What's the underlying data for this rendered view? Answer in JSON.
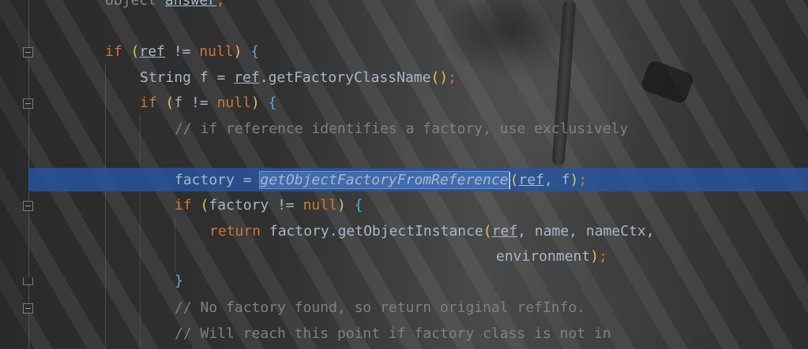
{
  "editor": {
    "lines": {
      "l0": {
        "kw": "Object",
        "var": "answer",
        "punct": ";"
      },
      "l1": {
        "kw": "if",
        "open": "(",
        "var": "ref",
        "op": " != ",
        "null": "null",
        "close": ")",
        "brace": "{"
      },
      "l2": {
        "type": "String",
        "name": " f = ",
        "var": "ref",
        "call": ".getFactoryClassName",
        "parens": "()",
        "semi": ";"
      },
      "l3": {
        "kw": "if",
        "open": "(",
        "cond": "f != ",
        "null": "null",
        "close": ")",
        "brace": "{"
      },
      "l4": {
        "comment": "// if reference identifies a factory, use exclusively"
      },
      "l5": {
        "lhs": "factory = ",
        "method": "getObjectFactoryFromReference",
        "open": "(",
        "arg1": "ref",
        "sep": ", f",
        "close": ")",
        "semi": ";"
      },
      "l6": {
        "kw": "if",
        "open": "(",
        "cond": "factory != ",
        "null": "null",
        "close": ")",
        "brace": "{"
      },
      "l7": {
        "kw": "return",
        "call": " factory.getObjectInstance",
        "open": "(",
        "arg1": "ref",
        "rest": ", name, nameCtx,"
      },
      "l8": {
        "text": "environment",
        "close": ")",
        "semi": ";"
      },
      "l9": {
        "brace": "}"
      },
      "l10": {
        "comment": "// No factory found, so return original refInfo."
      },
      "l11": {
        "comment": "// Will reach this point if factory class is not in"
      }
    },
    "colors": {
      "keyword": "#cc7832",
      "comment": "#808080",
      "text": "#a9b7c6",
      "caret_line": "#2656a0"
    }
  }
}
